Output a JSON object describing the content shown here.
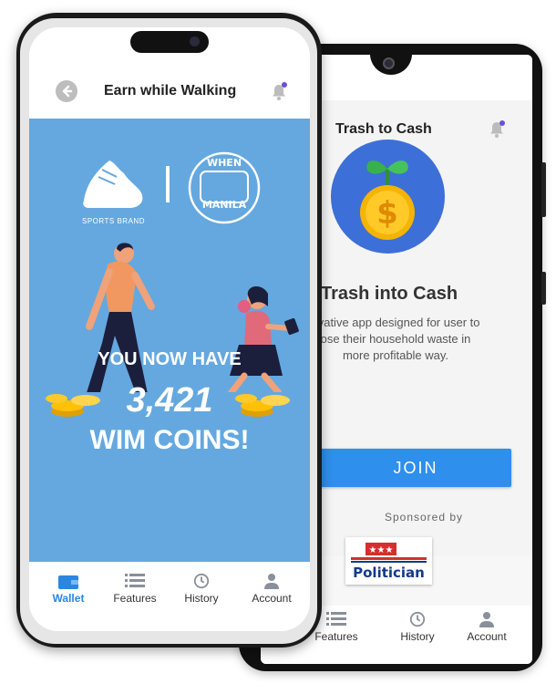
{
  "back_phone": {
    "header": {
      "title": "Trash to Cash",
      "bell_icon": "bell-icon"
    },
    "hero_icon": "dollar-sprout-icon",
    "heading": "Trash into Cash",
    "description_lines": [
      "ovative app designed for user to",
      "ose their household waste in",
      "more profitable way."
    ],
    "join_label": "JOIN",
    "sponsored_label": "Sponsored by",
    "sponsor_logo_text": "Politician",
    "nav": [
      {
        "label": "Features",
        "icon": "list-icon"
      },
      {
        "label": "History",
        "icon": "history-icon"
      },
      {
        "label": "Account",
        "icon": "account-icon"
      }
    ],
    "colors": {
      "accent": "#2f8fec",
      "coin_bg": "#3d6fd8"
    }
  },
  "front_phone": {
    "header": {
      "title": "Earn while Walking",
      "back_icon": "back-arrow-icon",
      "bell_icon": "bell-icon"
    },
    "brand_label": "SPORTS BRAND",
    "partner_logo_text": "WHEN IN MANILA",
    "line1": "YOU NOW HAVE",
    "coin_count": "3,421",
    "line3": "WIM COINS!",
    "nav": [
      {
        "label": "Wallet",
        "icon": "wallet-icon",
        "active": true
      },
      {
        "label": "Features",
        "icon": "list-icon"
      },
      {
        "label": "History",
        "icon": "history-icon"
      },
      {
        "label": "Account",
        "icon": "account-icon"
      }
    ],
    "colors": {
      "hero_bg": "#64a8df",
      "active_nav": "#2a86e0"
    }
  }
}
